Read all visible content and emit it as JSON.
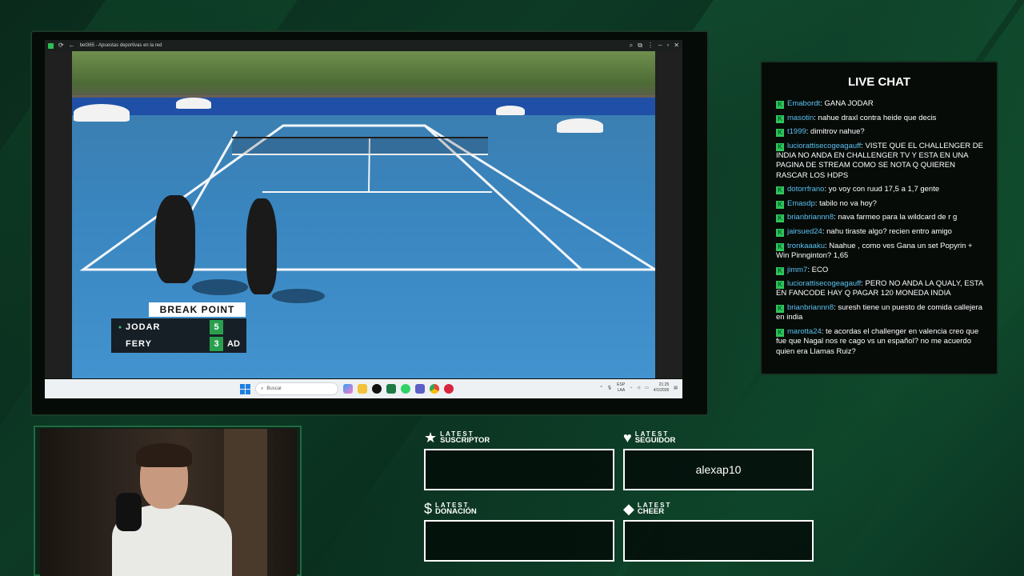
{
  "browser": {
    "tab_title": "bet365 - Apuestas deportivas en la red"
  },
  "scoreboard": {
    "banner": "BREAK POINT",
    "players": [
      {
        "name": "JODAR",
        "games": "5",
        "points": "",
        "serving": true
      },
      {
        "name": "FERY",
        "games": "3",
        "points": "AD",
        "serving": false
      }
    ]
  },
  "taskbar": {
    "search_placeholder": "Buscar",
    "lang_top": "ESP",
    "lang_bottom": "LAA",
    "time": "21:25",
    "date": "4/1/2026"
  },
  "chat": {
    "title": "LIVE CHAT",
    "messages": [
      {
        "user": "Emabordt",
        "text": ": GANA JODAR"
      },
      {
        "user": "masotin",
        "text": ": nahue draxl contra heide que decis"
      },
      {
        "user": "t1999",
        "text": ": dimitrov nahue?"
      },
      {
        "user": "luciorattisecogeagauff",
        "text": ": VISTE QUE EL CHALLENGER DE INDIA NO ANDA EN CHALLENGER TV Y ESTA EN UNA PAGINA DE STREAM COMO SE NOTA Q QUIEREN RASCAR LOS HDPS"
      },
      {
        "user": "dotorrfrano",
        "text": ": yo voy con ruud 17,5 a 1,7 gente"
      },
      {
        "user": "Emasdp",
        "text": ": tabilo no va hoy?"
      },
      {
        "user": "brianbriannn8",
        "text": ": nava farmeo para la wildcard de r g"
      },
      {
        "user": "jairsued24",
        "text": ": nahu tiraste algo? recien entro amigo"
      },
      {
        "user": "tronkaaaku",
        "text": ": Naahue , como ves Gana un set Popyrin + Win Pinnginton? 1,65"
      },
      {
        "user": "jimm7",
        "text": ": ECO"
      },
      {
        "user": "luciorattisecogeagauff",
        "text": ": PERO NO ANDA LA QUALY, ESTA EN FANCODE HAY Q PAGAR 120 MONEDA INDIA"
      },
      {
        "user": "brianbriannn8",
        "text": ": suresh tiene un puesto de comida callejera en india"
      },
      {
        "user": "marotta24",
        "text": ": te acordas el challenger en valencia creo que fue que Nagal nos re cago vs un español? no me acuerdo quien era Llamas Ruiz?"
      }
    ]
  },
  "alerts": {
    "subscriber": {
      "small": "LATEST",
      "big": "SUSCRIPTOR",
      "value": "",
      "icon": "star-icon"
    },
    "follower": {
      "small": "LATEST",
      "big": "SEGUIDOR",
      "value": "alexap10",
      "icon": "heart-icon"
    },
    "donation": {
      "small": "LATEST",
      "big": "DONACIÓN",
      "value": "",
      "icon": "dollar-icon"
    },
    "cheer": {
      "small": "LATEST",
      "big": "CHEER",
      "value": "",
      "icon": "diamond-icon"
    }
  },
  "colors": {
    "accent_green": "#30c45a",
    "chat_user": "#5bc0f0",
    "court_blue": "#3a86c0"
  }
}
